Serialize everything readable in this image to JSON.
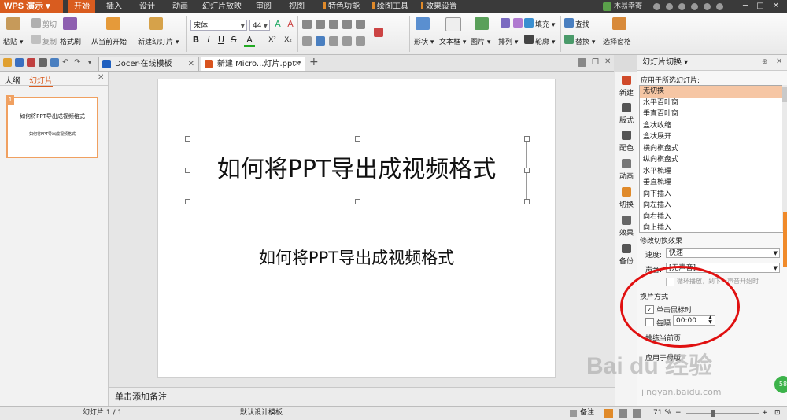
{
  "app": {
    "name": "WPS 演示"
  },
  "menu_tabs": [
    {
      "label": "开始",
      "active": true
    },
    {
      "label": "插入"
    },
    {
      "label": "设计"
    },
    {
      "label": "动画"
    },
    {
      "label": "幻灯片放映"
    },
    {
      "label": "审阅"
    },
    {
      "label": "视图"
    },
    {
      "label": "特色功能"
    },
    {
      "label": "绘图工具"
    },
    {
      "label": "效果设置"
    }
  ],
  "user": {
    "name": "木易幸寄"
  },
  "ribbon": {
    "paste": "粘贴",
    "cut": "剪切",
    "copy": "复制",
    "format_painter": "格式刷",
    "from_current": "从当前开始",
    "new_slide": "新建幻灯片",
    "font_name": "宋体",
    "font_size": "44",
    "bold": "B",
    "italic": "I",
    "underline": "U",
    "strike": "S",
    "superscript": "X²",
    "subscript": "X₂",
    "shape": "形状",
    "textbox": "文本框",
    "picture": "图片",
    "fill": "填充",
    "arrange": "排列",
    "outline": "轮廓",
    "find": "查找",
    "replace": "替换",
    "select_pane": "选择窗格"
  },
  "doc_tabs": [
    {
      "label": "Docer-在线模板"
    },
    {
      "label": "新建 Micro...灯片.ppt *",
      "active": true
    }
  ],
  "left_pane": {
    "tab_outline": "大纲",
    "tab_slides": "幻灯片",
    "thumb_num": "1",
    "thumb_title": "如何将PPT导出成视频格式",
    "thumb_sub": "如何将PPT导出成视频格式"
  },
  "slide": {
    "title": "如何将PPT导出成视频格式",
    "subtitle": "如何将PPT导出成视频格式"
  },
  "notes": "单击添加备注",
  "vtoolbar": [
    "新建",
    "版式",
    "配色",
    "动画",
    "切换",
    "效果",
    "备份"
  ],
  "task_pane": {
    "header": "幻灯片切换",
    "apply_label": "应用于所选幻灯片:",
    "transitions": [
      "无切换",
      "水平百叶窗",
      "垂直百叶窗",
      "盒状收缩",
      "盒状展开",
      "横向棋盘式",
      "纵向棋盘式",
      "水平梳理",
      "垂直梳理",
      "向下插入",
      "向左插入",
      "向右插入",
      "向上插入"
    ],
    "modify_label": "修改切换效果",
    "speed_label": "速度:",
    "speed_value": "快速",
    "sound_label": "声音:",
    "sound_value": "[无声音]",
    "loop_label": "循环播放，到下一声音开始时",
    "advance_label": "换片方式",
    "on_click": "单击鼠标时",
    "every_label": "每隔",
    "every_value": "00:00",
    "apply_all_label": "排练当前页",
    "apply_master": "应用于母版"
  },
  "watermark": {
    "text": "Bai du 经验",
    "sub": "jingyan.baidu.com"
  },
  "status": {
    "slide_count": "幻灯片 1 / 1",
    "template": "默认设计模板",
    "notes_btn": "备注",
    "zoom": "71 %"
  },
  "colors": {
    "accent": "#d95c1f",
    "selected": "#f6c6a4",
    "ellipse": "#e01010"
  }
}
